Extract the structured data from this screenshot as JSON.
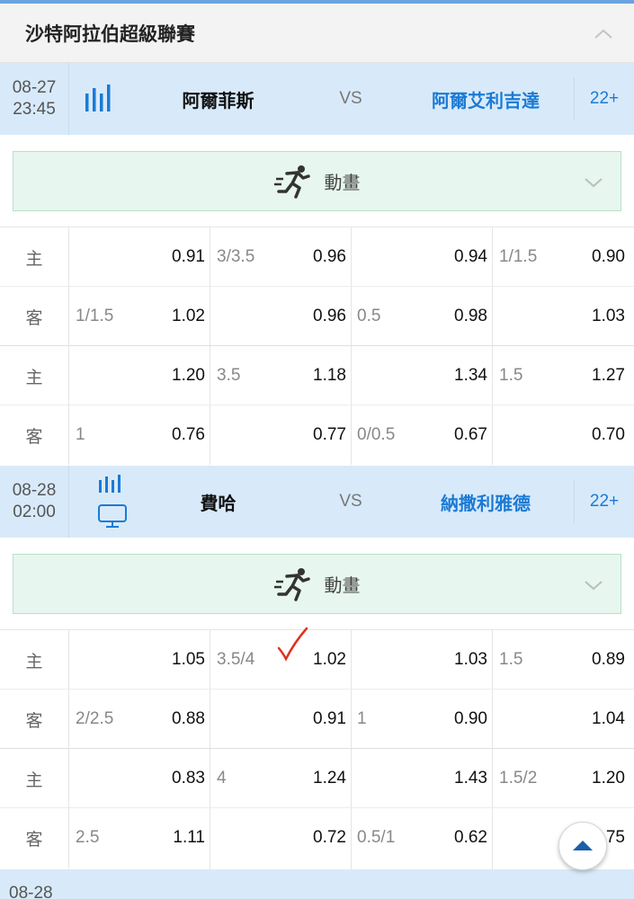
{
  "league": {
    "title": "沙特阿拉伯超級聯賽"
  },
  "vs_label": "VS",
  "animation_label": "動畫",
  "matches": [
    {
      "date": "08-27",
      "time": "23:45",
      "home": "阿爾菲斯",
      "away": "阿爾艾利吉達",
      "more": "22+",
      "has_tv": false,
      "odds": [
        {
          "side": "主",
          "hcap": "",
          "hodd": "0.91",
          "tl": "3/3.5",
          "tover": "0.96",
          "fhcap": "",
          "fhodd": "0.94",
          "ftl": "1/1.5",
          "ftover": "0.90"
        },
        {
          "side": "客",
          "hcap": "1/1.5",
          "hodd": "1.02",
          "tl": "",
          "tover": "0.96",
          "fhcap": "0.5",
          "fhodd": "0.98",
          "ftl": "",
          "ftover": "1.03"
        },
        {
          "side": "主",
          "hcap": "",
          "hodd": "1.20",
          "tl": "3.5",
          "tover": "1.18",
          "fhcap": "",
          "fhodd": "1.34",
          "ftl": "1.5",
          "ftover": "1.27"
        },
        {
          "side": "客",
          "hcap": "1",
          "hodd": "0.76",
          "tl": "",
          "tover": "0.77",
          "fhcap": "0/0.5",
          "fhodd": "0.67",
          "ftl": "",
          "ftover": "0.70"
        }
      ]
    },
    {
      "date": "08-28",
      "time": "02:00",
      "home": "費哈",
      "away": "納撒利雅德",
      "more": "22+",
      "has_tv": true,
      "odds": [
        {
          "side": "主",
          "hcap": "",
          "hodd": "1.05",
          "tl": "3.5/4",
          "tover": "1.02",
          "fhcap": "",
          "fhodd": "1.03",
          "ftl": "1.5",
          "ftover": "0.89"
        },
        {
          "side": "客",
          "hcap": "2/2.5",
          "hodd": "0.88",
          "tl": "",
          "tover": "0.91",
          "fhcap": "1",
          "fhodd": "0.90",
          "ftl": "",
          "ftover": "1.04"
        },
        {
          "side": "主",
          "hcap": "",
          "hodd": "0.83",
          "tl": "4",
          "tover": "1.24",
          "fhcap": "",
          "fhodd": "1.43",
          "ftl": "1.5/2",
          "ftover": "1.20"
        },
        {
          "side": "客",
          "hcap": "2.5",
          "hodd": "1.11",
          "tl": "",
          "tover": "0.72",
          "fhcap": "0.5/1",
          "fhodd": "0.62",
          "ftl": "",
          "ftover": ".75"
        }
      ]
    }
  ],
  "next_match": {
    "date": "08-28"
  },
  "colors": {
    "accent": "#1b7ad6",
    "header_bg": "#d8eaf9",
    "anim_bg": "#e7f6ee",
    "check": "#e0301e"
  },
  "icons": {
    "collapse": "chevron-up-icon",
    "expand": "chevron-down-icon",
    "stats": "bar-chart-icon",
    "tv": "tv-icon",
    "animation": "running-man-icon",
    "scroll": "arrow-up-icon"
  }
}
